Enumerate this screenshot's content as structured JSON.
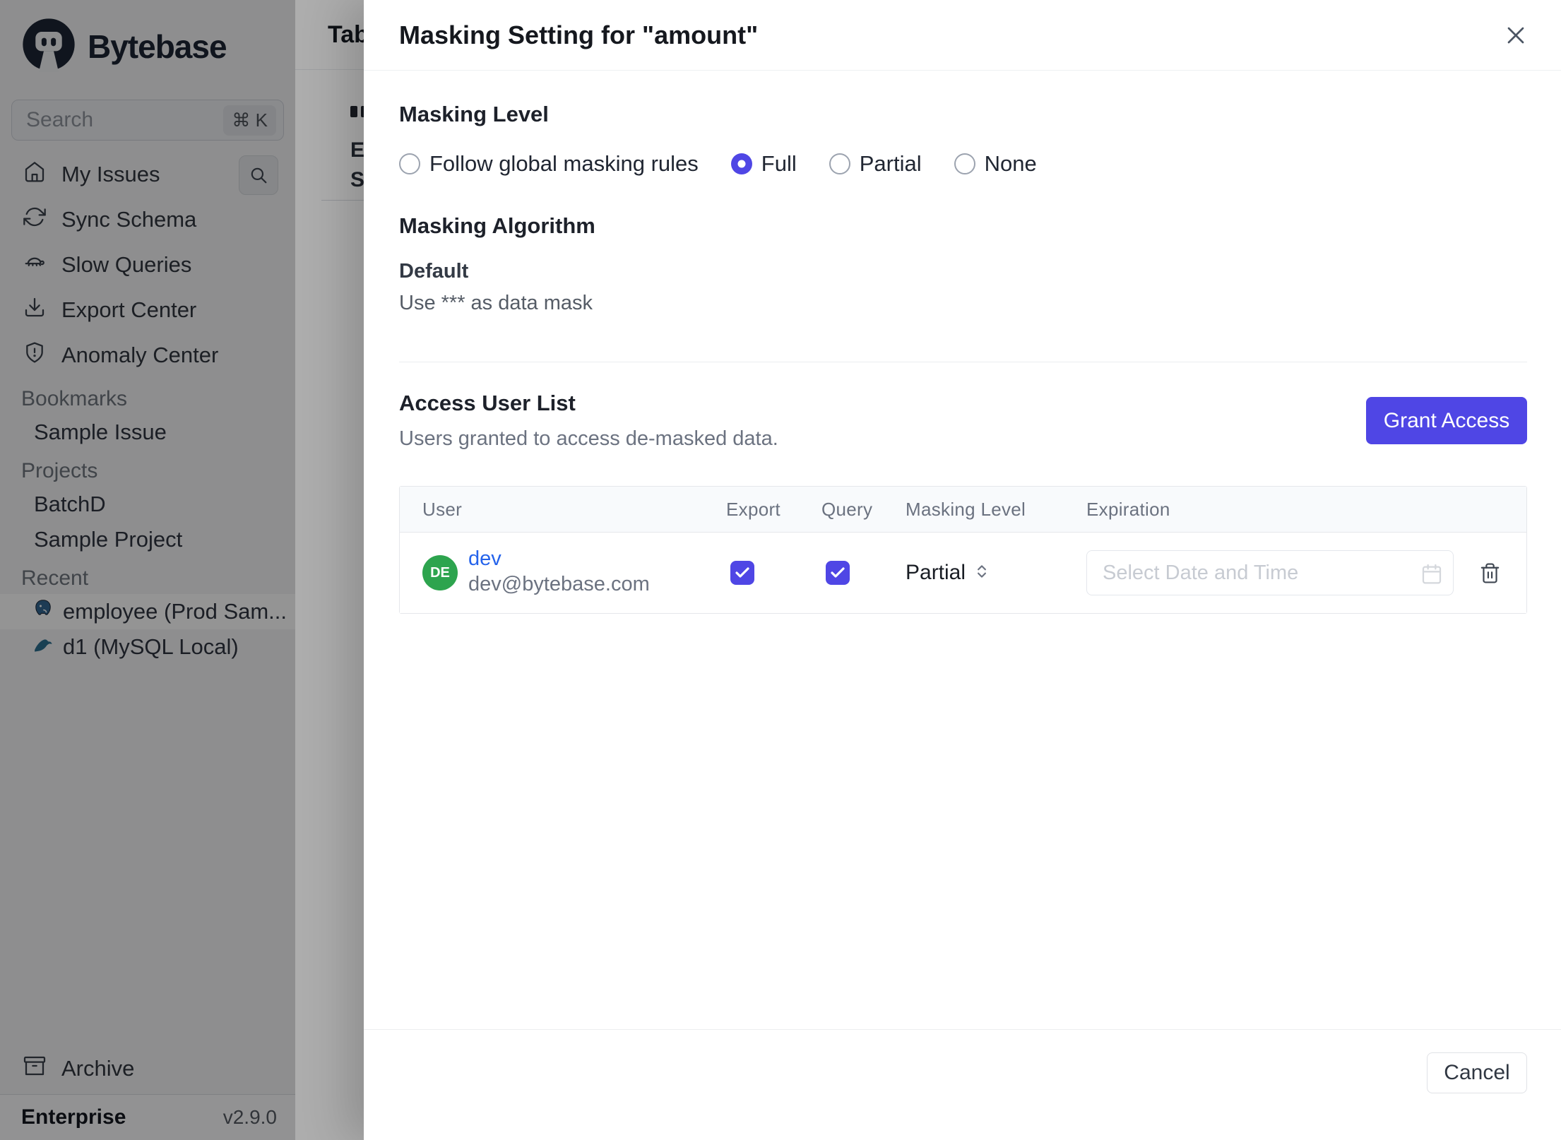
{
  "sidebar": {
    "logo_text": "Bytebase",
    "search": {
      "placeholder": "Search",
      "shortcut": "⌘ K"
    },
    "nav": [
      {
        "label": "My Issues"
      },
      {
        "label": "Sync Schema"
      },
      {
        "label": "Slow Queries"
      },
      {
        "label": "Export Center"
      },
      {
        "label": "Anomaly Center"
      }
    ],
    "sections": {
      "bookmarks": {
        "label": "Bookmarks",
        "item0": "Sample Issue"
      },
      "projects": {
        "label": "Projects",
        "item0": "BatchD",
        "item1": "Sample Project"
      },
      "recent": {
        "label": "Recent",
        "item0": "employee (Prod Sam...",
        "item1": "d1 (MySQL Local)"
      }
    },
    "archive_label": "Archive",
    "plan": "Enterprise",
    "version": "v2.9.0"
  },
  "background_page": {
    "clipped_title": "Tab",
    "clipped_tab_1": "E",
    "clipped_tab_2": "S"
  },
  "modal": {
    "title": "Masking Setting for \"amount\"",
    "masking_level": {
      "heading": "Masking Level",
      "options": [
        {
          "label": "Follow global masking rules",
          "selected": false
        },
        {
          "label": "Full",
          "selected": true
        },
        {
          "label": "Partial",
          "selected": false
        },
        {
          "label": "None",
          "selected": false
        }
      ]
    },
    "masking_algorithm": {
      "heading": "Masking Algorithm",
      "name": "Default",
      "description": "Use *** as data mask"
    },
    "access_user_list": {
      "heading": "Access User List",
      "subtitle": "Users granted to access de-masked data.",
      "grant_button": "Grant Access",
      "table": {
        "columns": [
          "User",
          "Export",
          "Query",
          "Masking Level",
          "Expiration"
        ],
        "rows": [
          {
            "avatar_initials": "DE",
            "name": "dev",
            "email": "dev@bytebase.com",
            "export_checked": true,
            "query_checked": true,
            "masking_level": "Partial",
            "expiration_placeholder": "Select Date and Time"
          }
        ]
      }
    },
    "cancel_button": "Cancel"
  },
  "colors": {
    "accent": "#4f46e5",
    "link_blue": "#2563eb",
    "avatar_green": "#2da44e"
  }
}
